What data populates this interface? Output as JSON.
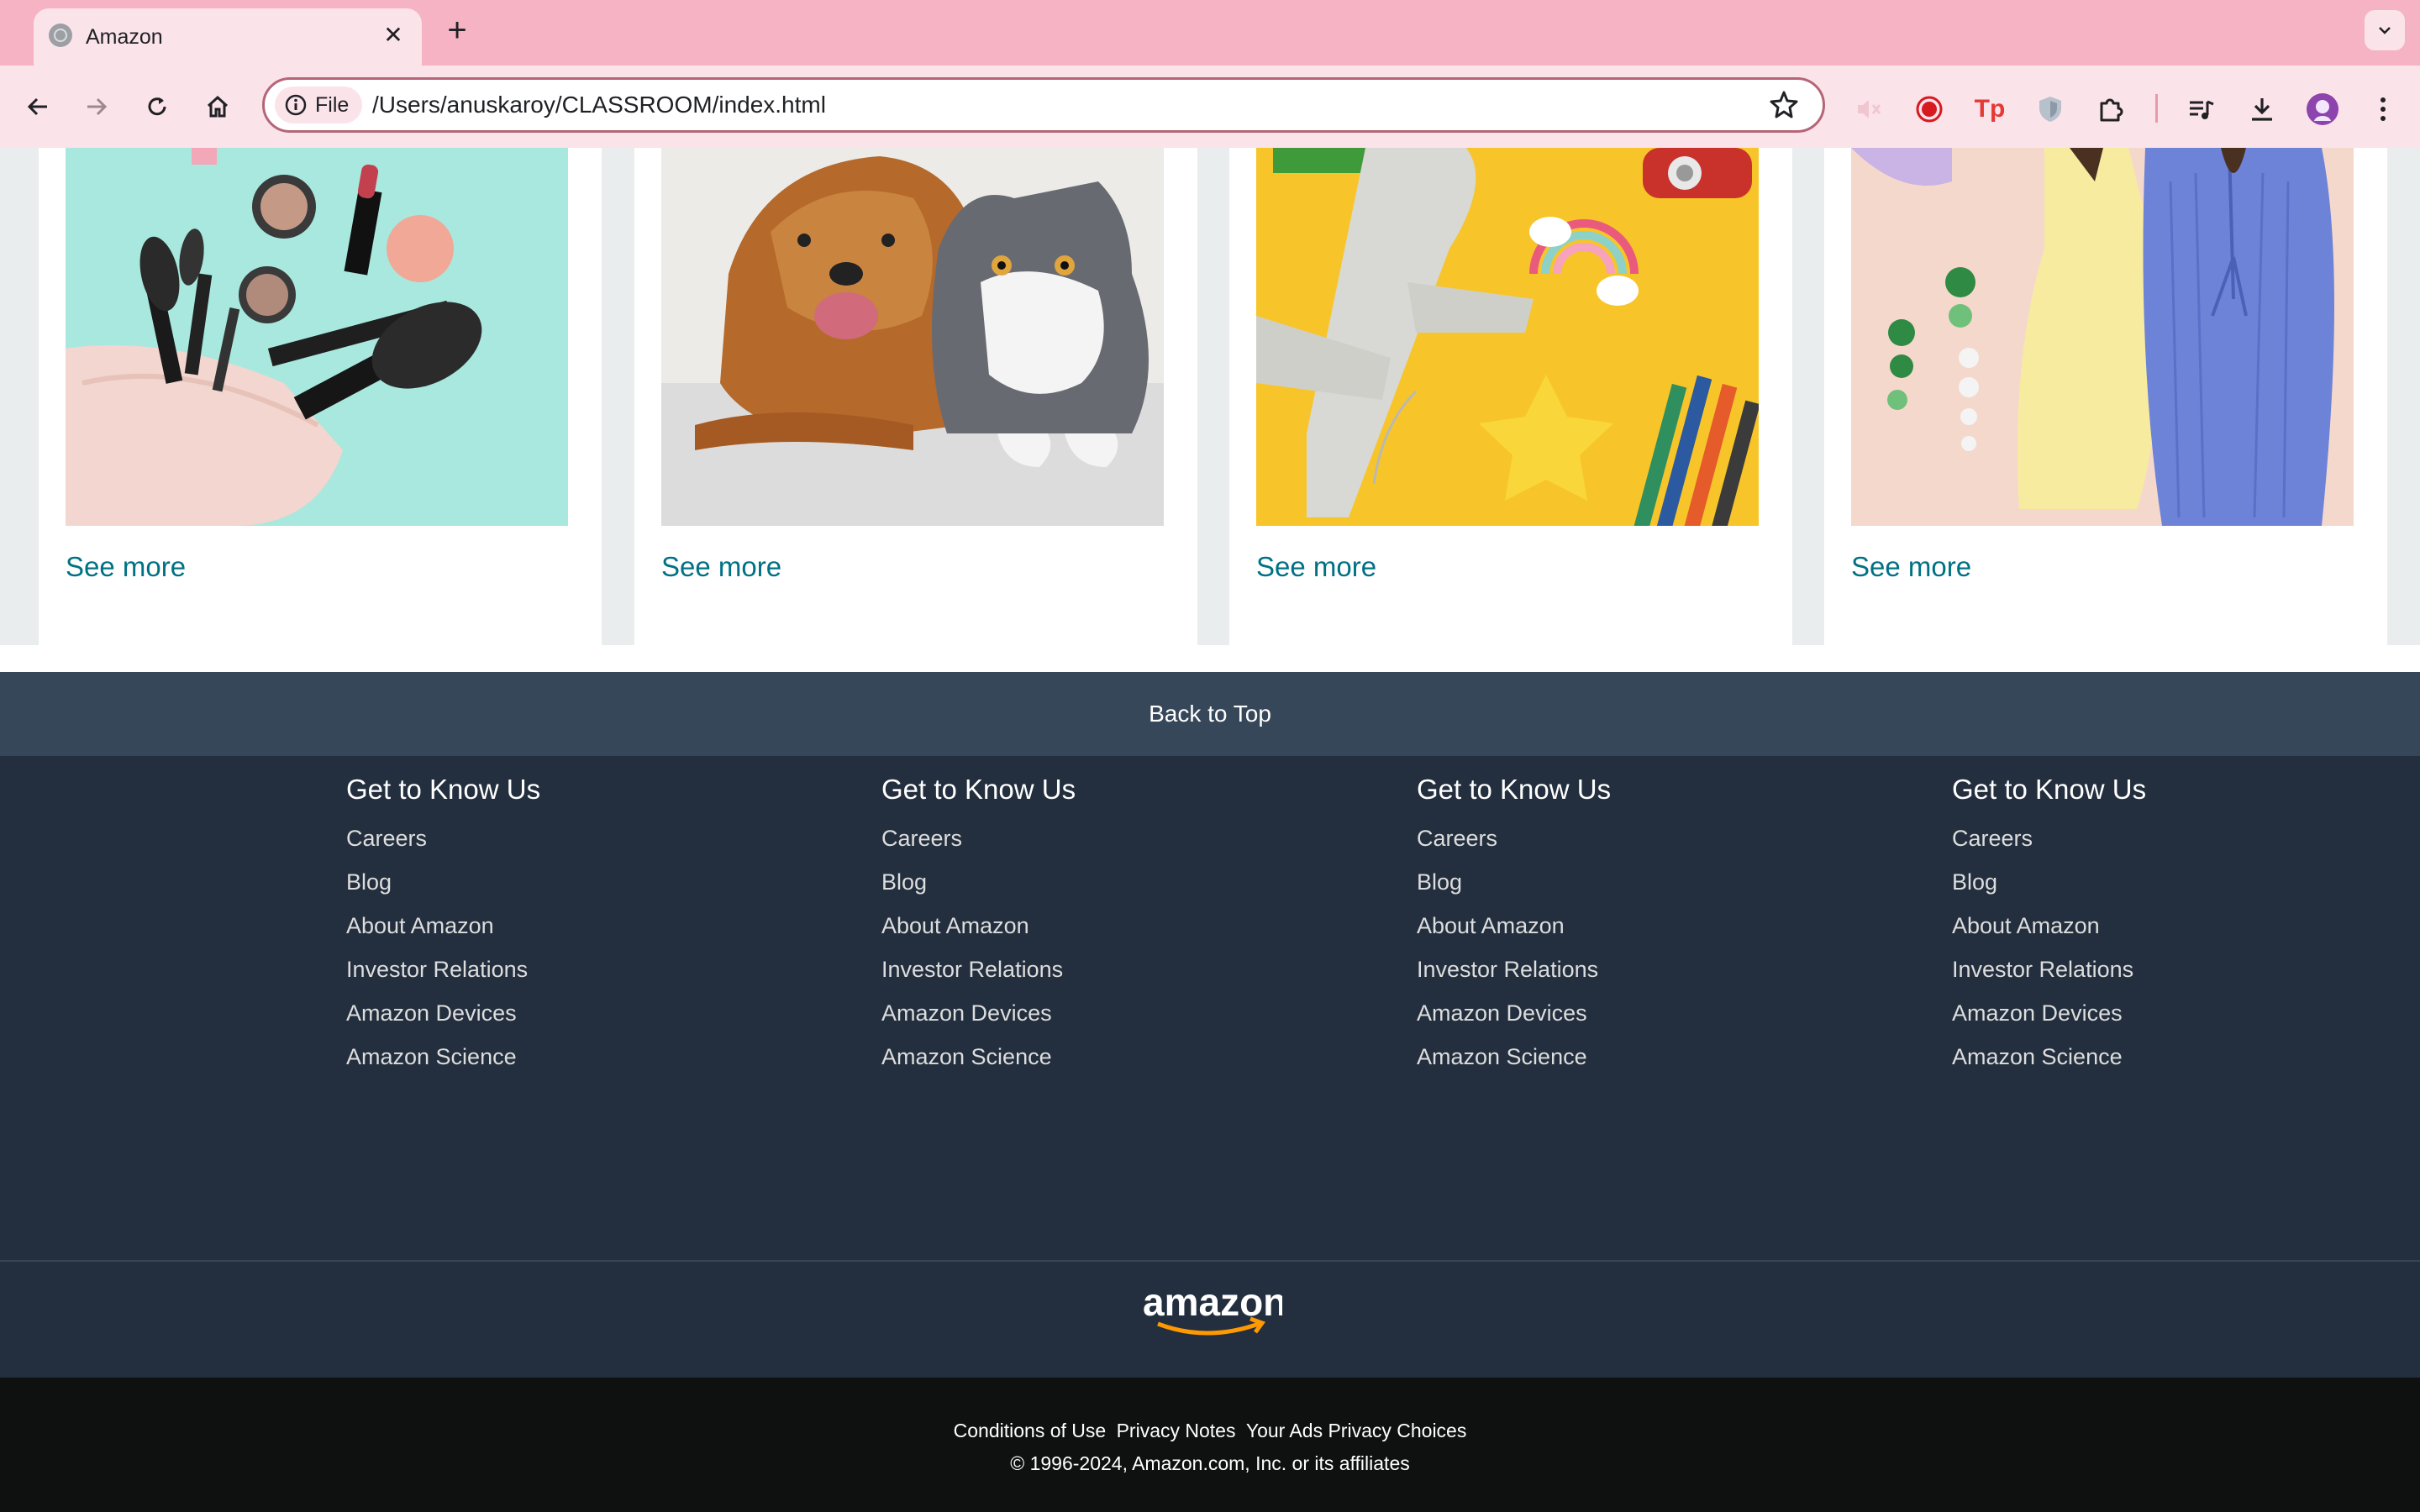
{
  "browser": {
    "tab_title": "Amazon",
    "site_chip": "File",
    "url": "/Users/anuskaroy/CLASSROOM/index.html"
  },
  "cards": [
    {
      "image": "makeup-brushes-and-cosmetic-bag",
      "link": "See more"
    },
    {
      "image": "golden-retriever-and-gray-cat",
      "link": "See more"
    },
    {
      "image": "toy-airplane-and-colored-pencils",
      "link": "See more"
    },
    {
      "image": "women-fashion-dresses-and-earrings",
      "link": "See more"
    }
  ],
  "back_to_top": "Back to Top",
  "footer": {
    "columns": [
      {
        "heading": "Get to Know Us",
        "links": [
          "Careers",
          "Blog",
          "About Amazon",
          "Investor Relations",
          "Amazon Devices",
          "Amazon Science"
        ]
      },
      {
        "heading": "Get to Know Us",
        "links": [
          "Careers",
          "Blog",
          "About Amazon",
          "Investor Relations",
          "Amazon Devices",
          "Amazon Science"
        ]
      },
      {
        "heading": "Get to Know Us",
        "links": [
          "Careers",
          "Blog",
          "About Amazon",
          "Investor Relations",
          "Amazon Devices",
          "Amazon Science"
        ]
      },
      {
        "heading": "Get to Know Us",
        "links": [
          "Careers",
          "Blog",
          "About Amazon",
          "Investor Relations",
          "Amazon Devices",
          "Amazon Science"
        ]
      }
    ],
    "logo_text": "amazon",
    "legal_links": [
      "Conditions of Use",
      "Privacy Notes",
      "Your Ads Privacy Choices"
    ],
    "copyright": "© 1996-2024, Amazon.com, Inc. or its affiliates"
  },
  "colors": {
    "tabbar": "#f5b3c3",
    "toolbar": "#fbe3ea",
    "link": "#007185",
    "back_to_top_bg": "#37475a",
    "footer_bg": "#232f3e",
    "bottom_bg": "#0f1111",
    "logo_smile": "#ff9900"
  }
}
